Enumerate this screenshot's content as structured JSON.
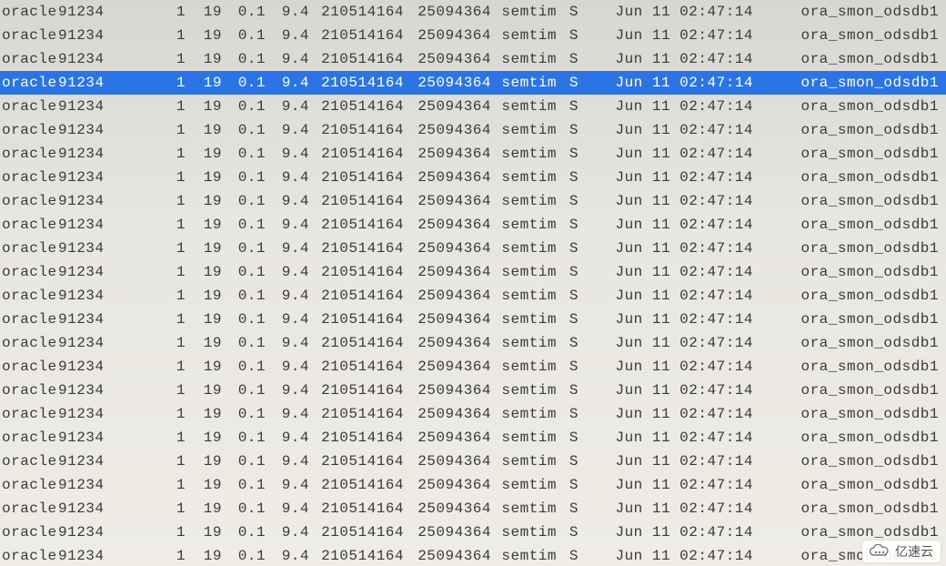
{
  "selectedIndex": 3,
  "rowCount": 24,
  "row": {
    "user": "oracle",
    "pid": "91234",
    "n1": "1",
    "n2": "19",
    "n3": "0.1",
    "n4": "9.4",
    "n5": "210514164",
    "n6": "25094364",
    "sem": "semtim",
    "stat": "S",
    "date": "Jun 11 02:47:14",
    "cmd": "ora_smon_odsdb1"
  },
  "watermark": "亿速云"
}
